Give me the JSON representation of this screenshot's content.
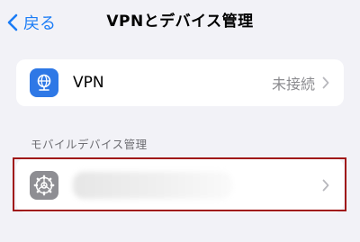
{
  "nav": {
    "back_label": "戻る",
    "title": "VPNとデバイス管理"
  },
  "vpn_row": {
    "label": "VPN",
    "value": "未接続",
    "icon": "vpn-globe-icon",
    "icon_color": "#2e78e6"
  },
  "section": {
    "header": "モバイルデバイス管理"
  },
  "device_row": {
    "icon": "gear-icon",
    "icon_color": "#8e8e93"
  },
  "colors": {
    "accent": "#1a7cf6",
    "background": "#f2f2f7",
    "highlight_border": "#a01818"
  }
}
